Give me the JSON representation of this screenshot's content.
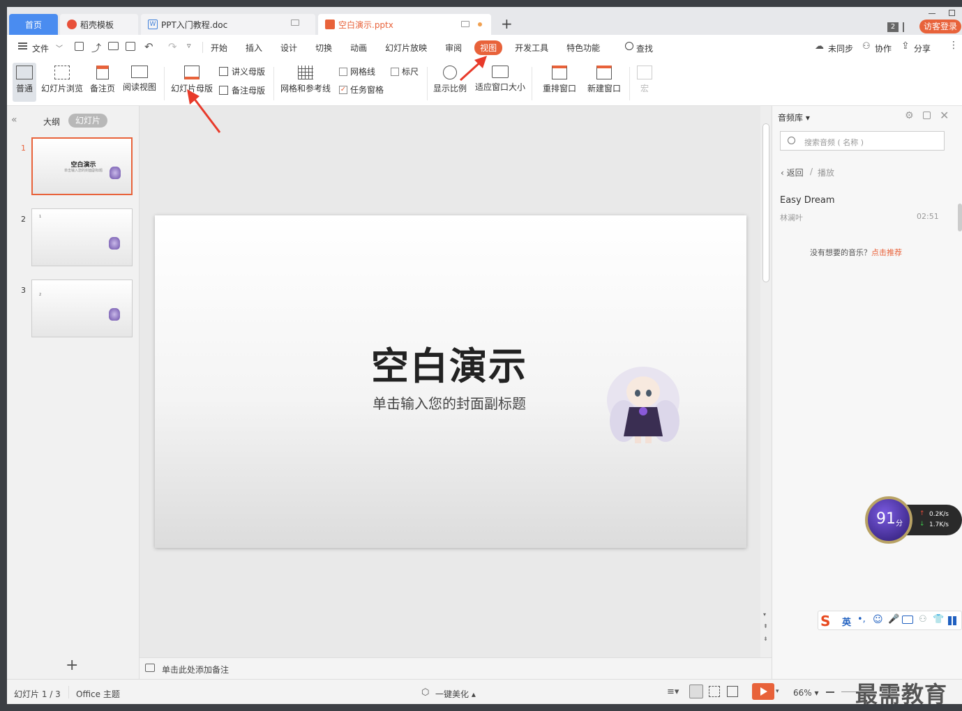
{
  "tabs": {
    "home": "首页",
    "template": "稻壳模板",
    "doc": "PPT入门教程.doc",
    "pptx": "空白演示.pptx",
    "new_tab": "+",
    "window_count": "2",
    "login": "访客登录"
  },
  "menubar": {
    "file": "文件",
    "items": [
      "开始",
      "插入",
      "设计",
      "切换",
      "动画",
      "幻灯片放映",
      "审阅",
      "视图",
      "开发工具",
      "特色功能"
    ],
    "find": "查找",
    "sync": "未同步",
    "collab": "协作",
    "share": "分享"
  },
  "ribbon": {
    "normal": "普通",
    "slide_browse": "幻灯片浏览",
    "notes_page": "备注页",
    "reading_view": "阅读视图",
    "slide_master": "幻灯片母版",
    "handout_master": "讲义母版",
    "notes_master": "备注母版",
    "grid_guides": "网格和参考线",
    "gridlines": "网格线",
    "ruler": "标尺",
    "task_pane": "任务窗格",
    "zoom_ratio": "显示比例",
    "fit_window": "适应窗口大小",
    "rearrange": "重排窗口",
    "new_window": "新建窗口",
    "macro": "宏"
  },
  "leftpanel": {
    "outline": "大纲",
    "slides": "幻灯片",
    "slide_numbers": [
      "1",
      "2",
      "3"
    ],
    "thumb1_title": "空白演示",
    "thumb1_sub": "单击输入您的封面副标题",
    "thumb2_mark": "1",
    "thumb3_mark": "2",
    "add": "+"
  },
  "slide": {
    "title": "空白演示",
    "subtitle": "单击输入您的封面副标题"
  },
  "notes": {
    "placeholder": "单击此处添加备注"
  },
  "rightpanel": {
    "title": "音频库",
    "search_placeholder": "搜索音频 ( 名称 )",
    "back": "返回",
    "play": "播放",
    "track_title": "Easy Dream",
    "track_artist": "林澜叶",
    "track_duration": "02:51",
    "no_music": "没有想要的音乐？",
    "recommend": "点击推荐"
  },
  "speed_widget": {
    "score": "91",
    "unit": "分",
    "up": "0.2K/s",
    "down": "1.7K/s"
  },
  "ime": {
    "lang": "英"
  },
  "statusbar": {
    "slide_count": "幻灯片 1 / 3",
    "theme": "Office 主题",
    "beautify": "一键美化",
    "zoom": "66%",
    "watermark": "最需教育"
  },
  "colors": {
    "accent": "#e8623a",
    "tab_blue": "#4a8cf0",
    "active_menu": "#e8623a"
  }
}
